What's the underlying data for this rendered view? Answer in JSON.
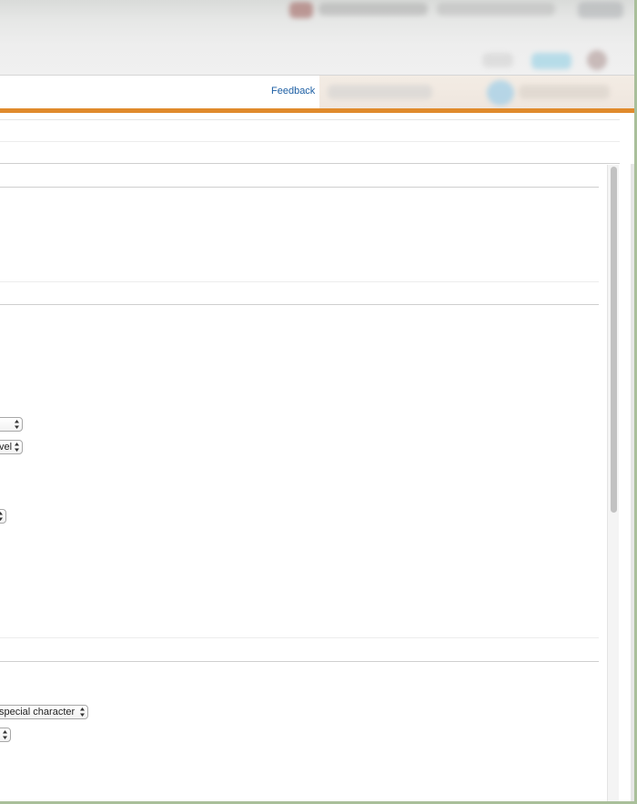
{
  "header": {
    "feedback_label": "Feedback"
  },
  "form": {
    "select_1": {
      "value": ""
    },
    "select_2": {
      "value": "vel"
    },
    "select_3": {
      "value": ""
    },
    "select_4": {
      "value": "special character"
    },
    "select_5": {
      "value": ""
    }
  },
  "colors": {
    "accent_orange": "#e08a2c",
    "link_blue": "#1d5fa4",
    "background_green": "#a9bf9a"
  },
  "icons": {
    "select_arrows": "updown-arrows-icon"
  }
}
